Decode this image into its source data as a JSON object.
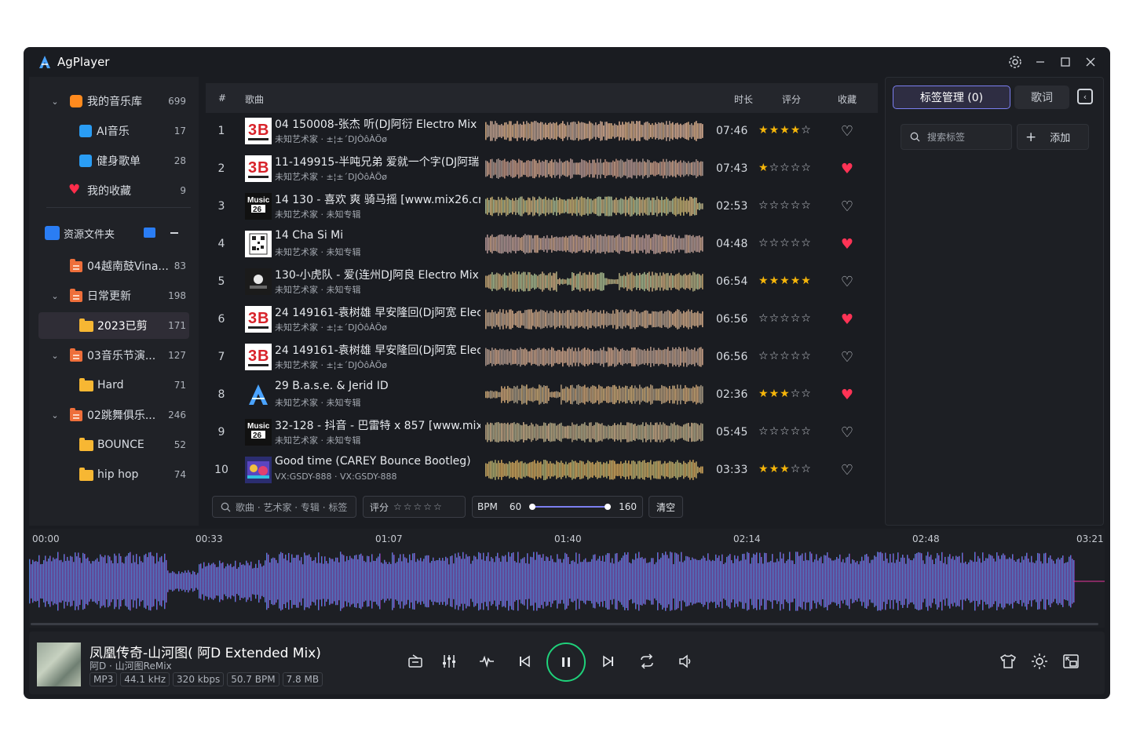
{
  "app": {
    "title": "AgPlayer"
  },
  "sidebar": {
    "library": {
      "label": "我的音乐库",
      "count": "699"
    },
    "items": [
      {
        "label": "AI音乐",
        "count": "17"
      },
      {
        "label": "健身歌单",
        "count": "28"
      },
      {
        "label": "我的收藏",
        "count": "9"
      }
    ],
    "resources": {
      "label": "资源文件夹"
    },
    "folders": [
      {
        "label": "04越南鼓Vina...",
        "count": "83"
      },
      {
        "label": "日常更新",
        "count": "198"
      },
      {
        "label": "2023已剪",
        "count": "171"
      },
      {
        "label": "03音乐节演...",
        "count": "127"
      },
      {
        "label": "Hard",
        "count": "71"
      },
      {
        "label": "02跳舞俱乐...",
        "count": "246"
      },
      {
        "label": "BOUNCE",
        "count": "52"
      },
      {
        "label": "hip hop",
        "count": "74"
      }
    ]
  },
  "table": {
    "headers": {
      "num": "#",
      "song": "歌曲",
      "duration": "时长",
      "rating": "评分",
      "favorite": "收藏"
    },
    "rows": [
      {
        "num": "1",
        "title": "04  150008-张杰 听(DJ阿衍 Electro Mix",
        "sub": "未知艺术家 · ±¦±´DJÒôÀÖø",
        "duration": "07:46",
        "rating": 4,
        "fav": false,
        "cover": "3b"
      },
      {
        "num": "2",
        "title": "11-149915-半吨兄弟 爱就一个字(DJ阿瑞",
        "sub": "未知艺术家 · ±¦±´DJÒôÀÖø",
        "duration": "07:43",
        "rating": 1,
        "fav": true,
        "cover": "3b"
      },
      {
        "num": "3",
        "title": "14  130 - 喜欢 爽 骑马摇 [www.mix26.cn",
        "sub": "未知艺术家 · 未知专辑",
        "duration": "02:53",
        "rating": 0,
        "fav": false,
        "cover": "music26"
      },
      {
        "num": "4",
        "title": "14 Cha Si Mi",
        "sub": "未知艺术家 · 未知专辑",
        "duration": "04:48",
        "rating": 0,
        "fav": true,
        "cover": "qr"
      },
      {
        "num": "5",
        "title": "130-小虎队 - 爱(连州DJ阿良 Electro Mix",
        "sub": "未知艺术家 · 未知专辑",
        "duration": "06:54",
        "rating": 5,
        "fav": false,
        "cover": "dark"
      },
      {
        "num": "6",
        "title": "24  149161-袁树雄 早安隆回(Dj阿宽 Elec",
        "sub": "未知艺术家 · ±¦±´DJÒôÀÖø",
        "duration": "06:56",
        "rating": 0,
        "fav": true,
        "cover": "3b"
      },
      {
        "num": "7",
        "title": "24  149161-袁树雄 早安隆回(Dj阿宽 Elec",
        "sub": "未知艺术家 · ±¦±´DJÒôÀÖø",
        "duration": "06:56",
        "rating": 0,
        "fav": false,
        "cover": "3b"
      },
      {
        "num": "8",
        "title": "29  B.a.s.e. & Jerid ID",
        "sub": "未知艺术家 · 未知专辑",
        "duration": "02:36",
        "rating": 3,
        "fav": true,
        "cover": "logo"
      },
      {
        "num": "9",
        "title": "32-128 - 抖音 - 巴雷特 x 857 [www.mix",
        "sub": "未知艺术家 · 未知专辑",
        "duration": "05:45",
        "rating": 0,
        "fav": false,
        "cover": "music26"
      },
      {
        "num": "10",
        "title": "Good time (CAREY Bounce Bootleg)",
        "sub": "VX:GSDY-888 · VX:GSDY-888",
        "duration": "03:33",
        "rating": 3,
        "fav": false,
        "cover": "colorful"
      }
    ]
  },
  "filters": {
    "search_placeholder": "歌曲 · 艺术家 · 专辑 · 标签",
    "rating_label": "评分",
    "bpm_label": "BPM",
    "bpm_min": "60",
    "bpm_max": "160",
    "clear_label": "清空"
  },
  "rightpanel": {
    "tag_tab": "标签管理 (0)",
    "lyric_tab": "歌词",
    "tag_search_placeholder": "搜索标签",
    "add_label": "添加"
  },
  "timeline": {
    "labels": [
      "00:00",
      "00:33",
      "01:07",
      "01:40",
      "02:14",
      "02:48",
      "03:21"
    ]
  },
  "nowplaying": {
    "title": "凤凰传奇-山河图( 阿D Extended Mix)",
    "artist": "阿D · 山河图ReMix",
    "badges": [
      "MP3",
      "44.1 kHz",
      "320 kbps",
      "50.7 BPM",
      "7.8 MB"
    ]
  },
  "colors": {
    "accent": "#7b7ff0",
    "play_ring": "#1fd17a",
    "star": "#f5b50a",
    "heart": "#ff3355",
    "wave_start": "#13b7a0",
    "wave_mid": "#8a3ff0",
    "wave_end": "#e8359e"
  }
}
